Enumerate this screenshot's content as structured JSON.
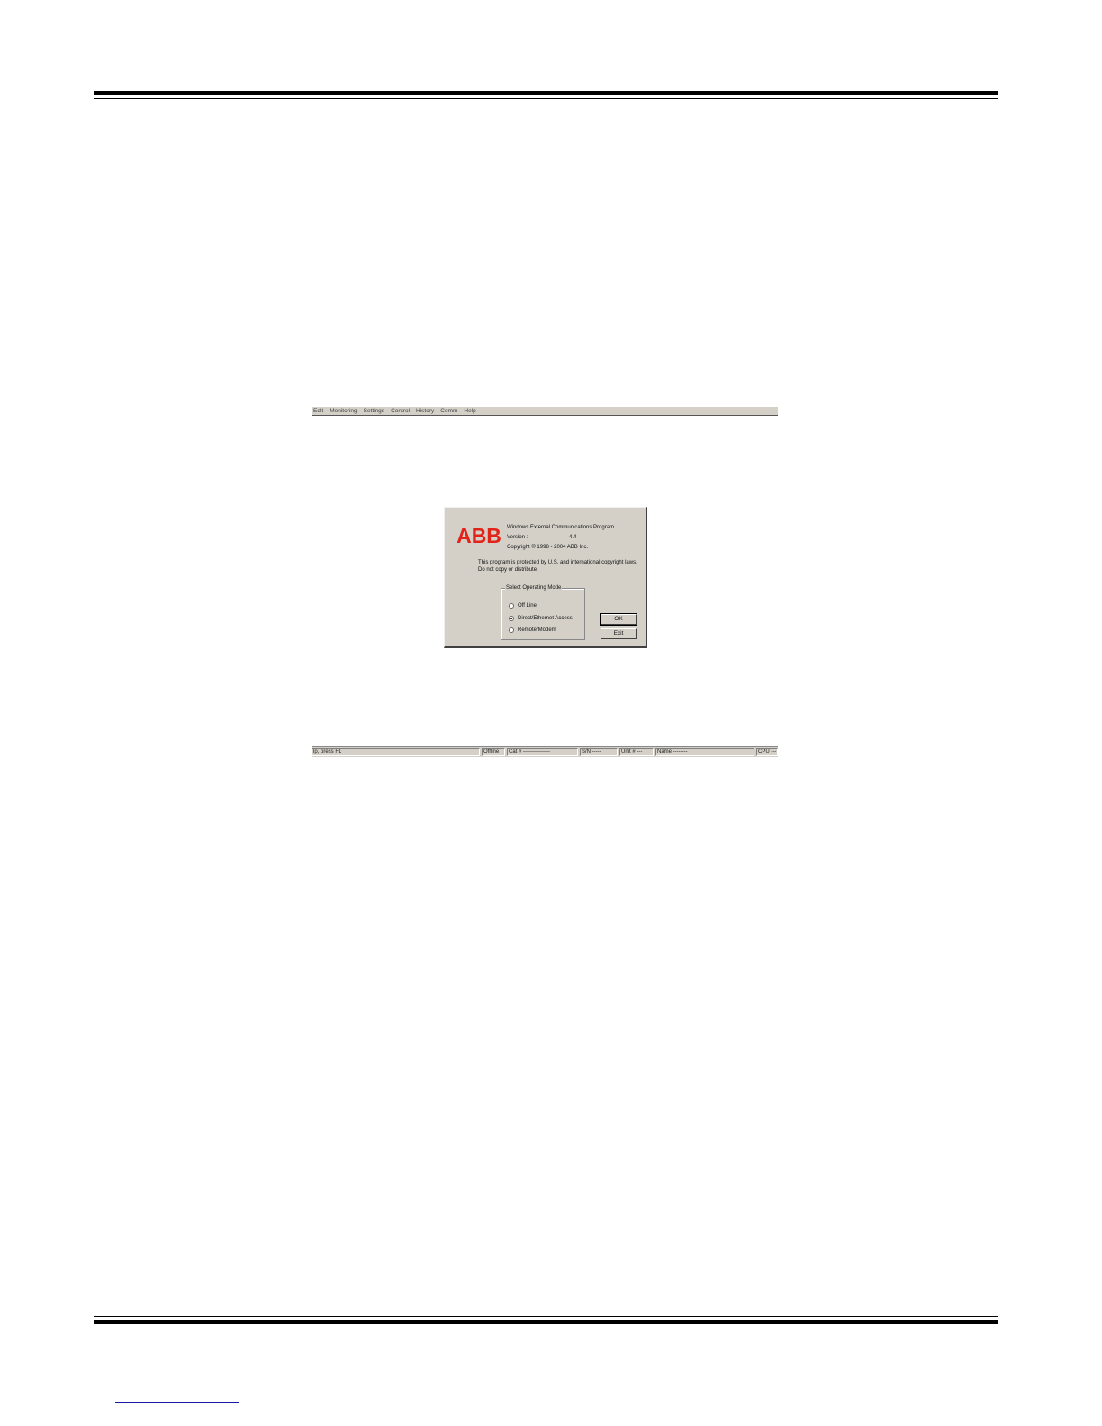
{
  "menubar": {
    "items": [
      "Edit",
      "Monitoring",
      "Settings",
      "Control",
      "History",
      "Comm",
      "Help"
    ]
  },
  "dialog": {
    "logo_text": "ABB",
    "program_name": "Windows External Communications Program",
    "version_label": "Version :",
    "version_value": "4.4",
    "copyright": "Copyright © 1998 - 2004 ABB Inc.",
    "notice_line1": "This program is protected by U.S. and international copyright laws.",
    "notice_line2": "Do not copy or distribute.",
    "mode_group_label": "Select Operating Mode",
    "modes": [
      {
        "label": "Off Line",
        "checked": false
      },
      {
        "label": "Direct/Ethernet Access",
        "checked": true
      },
      {
        "label": "Remote/Modem",
        "checked": false
      }
    ],
    "ok_label": "OK",
    "exit_label": "Exit"
  },
  "statusbar": {
    "help_hint": "lp, press F1",
    "mode": "Offline",
    "cat": "Cat # ---------------",
    "sn": "S/N -----",
    "unit": "Unit # ---",
    "name": "Name --------",
    "cpu": "CPU ---"
  },
  "colors": {
    "logo_red": "#e2231a",
    "dialog_gray": "#d4d0c8"
  }
}
